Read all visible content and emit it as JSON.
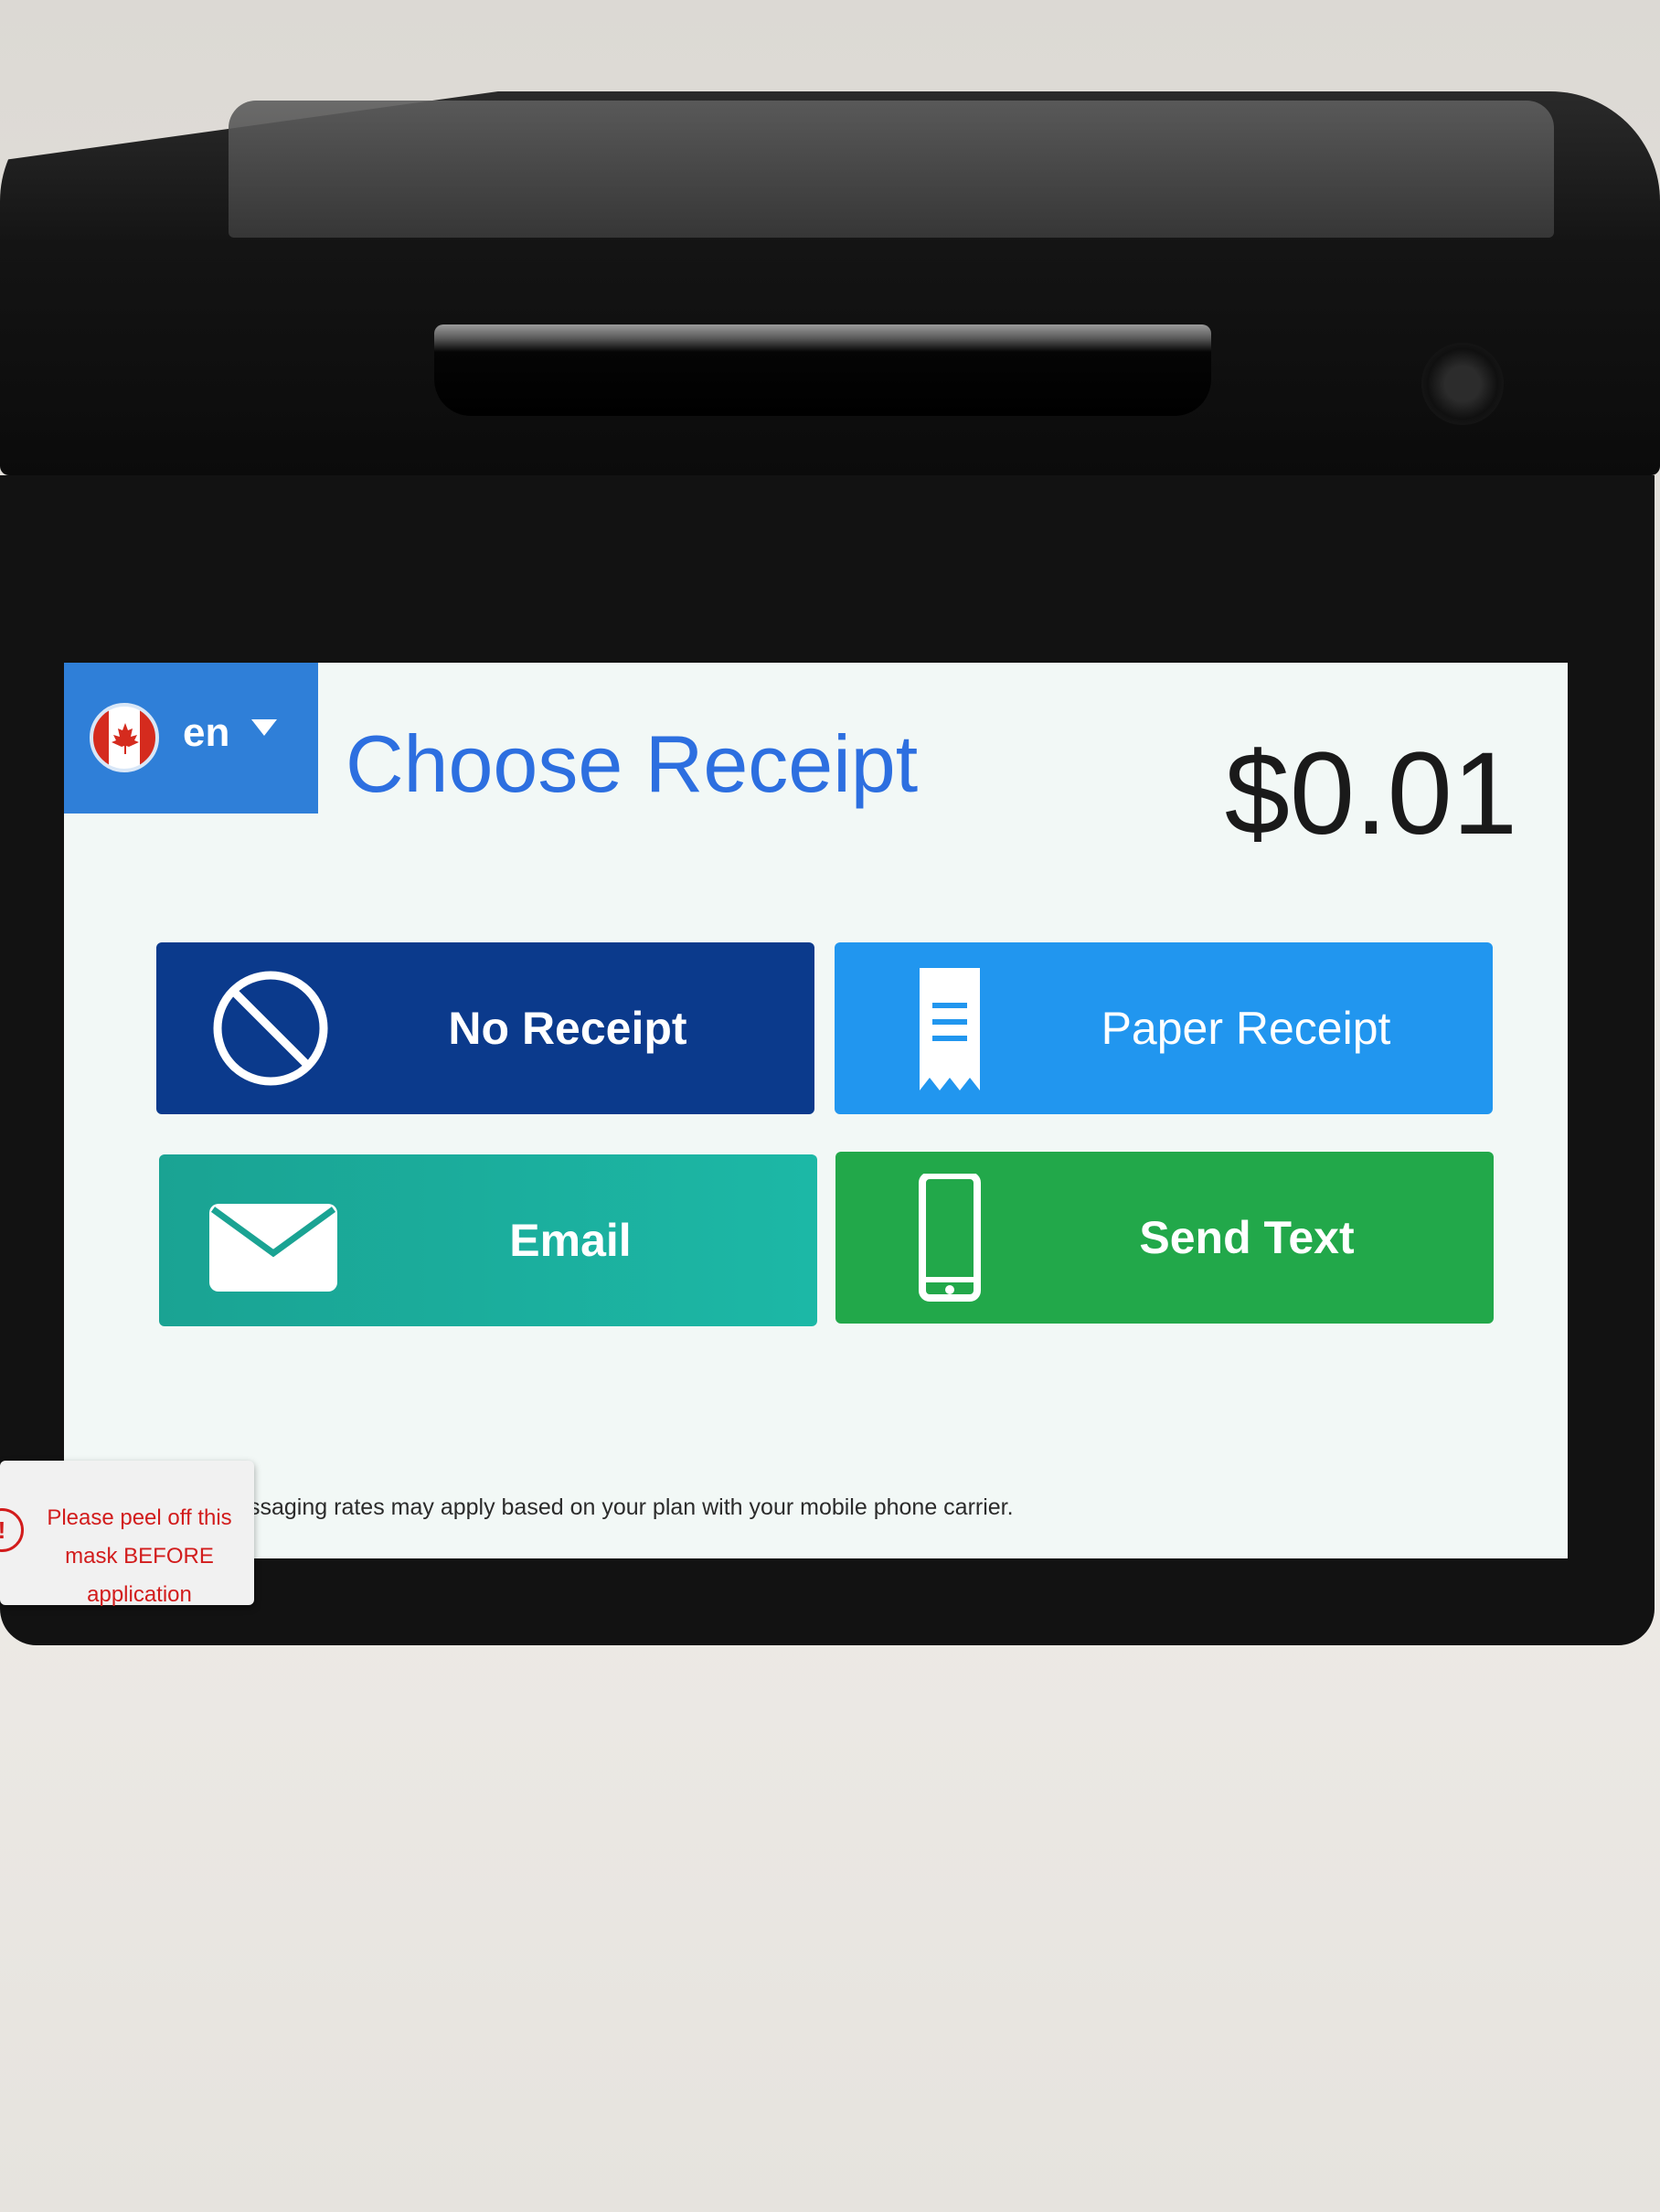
{
  "language": {
    "code": "en",
    "flag": "canada-flag-icon"
  },
  "header": {
    "title": "Choose Receipt",
    "amount": "$0.01"
  },
  "options": [
    {
      "label": "No Receipt",
      "icon": "no-sign-icon",
      "color": "#0b3a8c"
    },
    {
      "label": "Paper Receipt",
      "icon": "receipt-icon",
      "color": "#2196ef"
    },
    {
      "label": "Email",
      "icon": "envelope-icon",
      "color": "#1cb0a0"
    },
    {
      "label": "Send Text",
      "icon": "mobile-phone-icon",
      "color": "#22a84a"
    }
  ],
  "footer": {
    "disclaimer": "ssaging rates may apply based on your plan with your mobile phone carrier."
  },
  "sticker": {
    "line1": "Please peel off this",
    "line2": "mask BEFORE application",
    "color": "#d21c1c"
  }
}
